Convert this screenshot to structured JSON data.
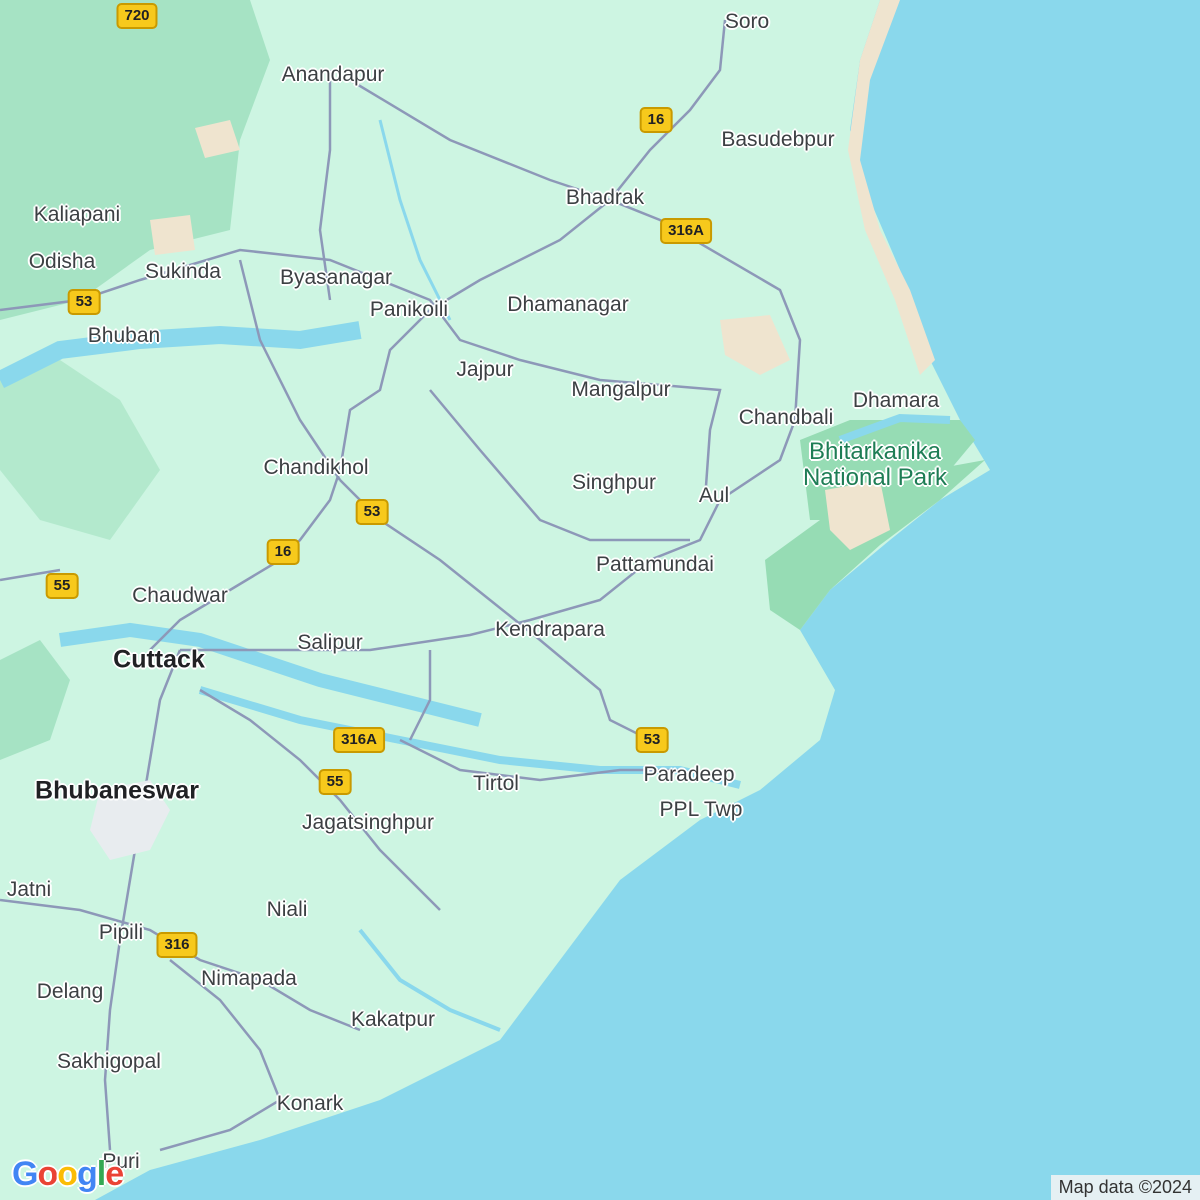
{
  "map": {
    "colors": {
      "land": "#cdf5e2",
      "water": "#8ad8ec",
      "forest": "#a6e3c4",
      "park": "#96dcb4",
      "sand": "#efe4cf",
      "road": "#8d98b8",
      "shield": "#f7c91c"
    },
    "labels": {
      "soro": "Soro",
      "anandapur": "Anandapur",
      "basudebpur": "Basudebpur",
      "bhadrak": "Bhadrak",
      "kaliapani": "Kaliapani",
      "odisha": "Odisha",
      "sukinda": "Sukinda",
      "byasanagar": "Byasanagar",
      "panikoili": "Panikoili",
      "dhamanagar": "Dhamanagar",
      "bhuban": "Bhuban",
      "jajpur": "Jajpur",
      "mangalpur": "Mangalpur",
      "dhamara": "Dhamara",
      "chandbali": "Chandbali",
      "chandikhol": "Chandikhol",
      "singhpur": "Singhpur",
      "aul": "Aul",
      "pattamundai": "Pattamundai",
      "chaudwar": "Chaudwar",
      "salipur": "Salipur",
      "kendrapara": "Kendrapara",
      "cuttack": "Cuttack",
      "paradeep": "Paradeep",
      "ppl_twp": "PPL Twp",
      "tirtol": "Tirtol",
      "bhubaneswar": "Bhubaneswar",
      "jagatsinghpur": "Jagatsinghpur",
      "jatni": "Jatni",
      "niali": "Niali",
      "pipili": "Pipili",
      "nimapada": "Nimapada",
      "delang": "Delang",
      "kakatpur": "Kakatpur",
      "sakhigopal": "Sakhigopal",
      "konark": "Konark",
      "puri": "Puri"
    },
    "park_label": [
      "Bhitarkanika",
      "National Park"
    ],
    "shields": {
      "s720": "720",
      "s16a": "16",
      "s316a_top": "316A",
      "s53_left": "53",
      "s53_mid": "53",
      "s16b": "16",
      "s55_left": "55",
      "s316a_bot": "316A",
      "s55_bot": "55",
      "s53_para": "53",
      "s316": "316"
    },
    "attribution": "Map data ©2024",
    "logo": {
      "g1": "G",
      "o1": "o",
      "o2": "o",
      "g2": "g",
      "l": "l",
      "e": "e"
    }
  }
}
